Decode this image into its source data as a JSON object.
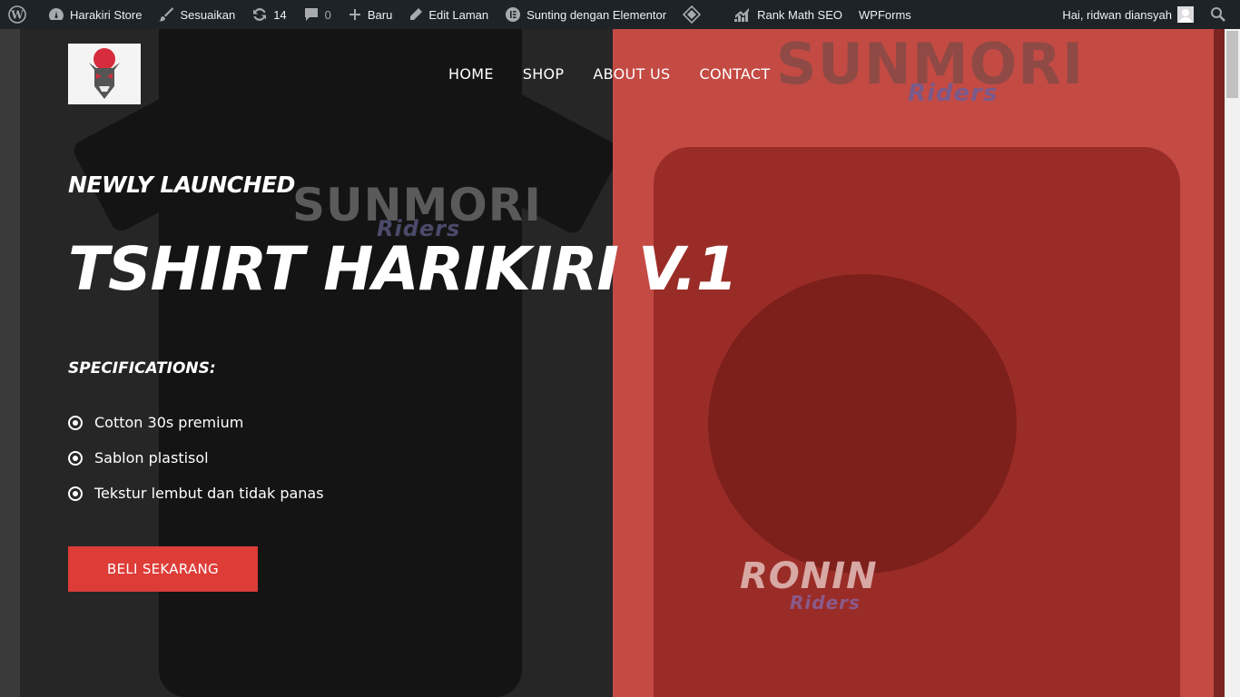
{
  "adminbar": {
    "site_name": "Harakiri Store",
    "customize": "Sesuaikan",
    "updates_count": "14",
    "comments_count": "0",
    "new": "Baru",
    "edit_page": "Edit Laman",
    "elementor": "Sunting dengan Elementor",
    "rank_math": "Rank Math SEO",
    "wpforms": "WPForms",
    "greeting": "Hai, ridwan diansyah"
  },
  "nav": {
    "items": [
      "HOME",
      "SHOP",
      "ABOUT US",
      "CONTACT"
    ]
  },
  "hero": {
    "eyebrow": "NEWLY LAUNCHED",
    "title": "TSHIRT HARIKIRI V.1",
    "spec_title": "SPECIFICATIONS:",
    "specs": [
      "Cotton 30s premium",
      "Sablon plastisol",
      "Tekstur lembut dan tidak panas"
    ],
    "cta": "BELI SEKARANG"
  },
  "prints": {
    "front_brand": "SUNMORI",
    "front_sub": "Riders",
    "back_brand": "RONIN",
    "back_sub": "Riders"
  },
  "colors": {
    "adminbar": "#1d2327",
    "left_overlay": "#262626",
    "right_overlay": "#c44a44",
    "cta": "#dd3c37"
  }
}
